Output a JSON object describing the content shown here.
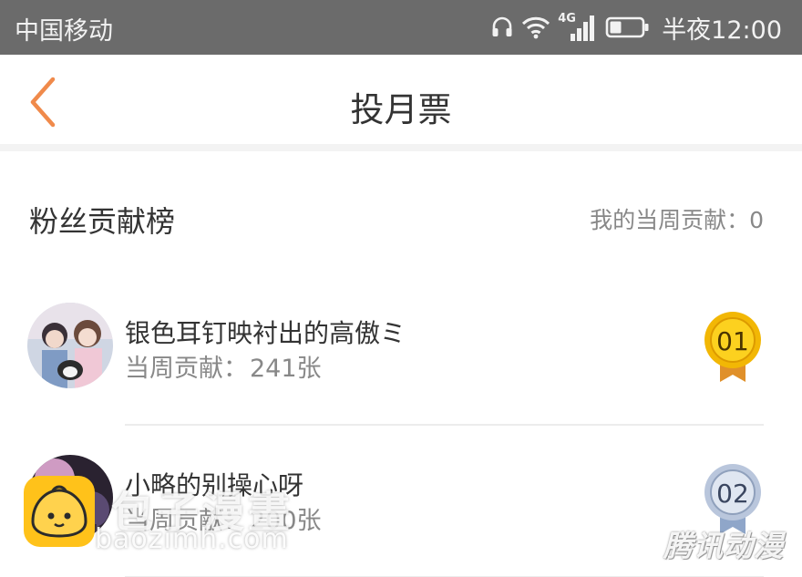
{
  "status_bar": {
    "carrier": "中国移动",
    "network_label": "4G",
    "clock": "半夜12:00",
    "icons": [
      "headphones-icon",
      "wifi-icon",
      "signal-icon",
      "battery-icon"
    ]
  },
  "nav": {
    "title": "投月票",
    "back_icon": "chevron-left-icon",
    "accent_color": "#f08a4b"
  },
  "section": {
    "title": "粉丝贡献榜",
    "my_contribution": "我的当周贡献：0"
  },
  "ranking": [
    {
      "rank": "01",
      "name": "银色耳钉映衬出的高傲ミ",
      "contribution_label": "当周贡献：",
      "contribution_value": "241张",
      "medal_color": "#f2b705",
      "ribbon_color": "#e0902a"
    },
    {
      "rank": "02",
      "name": "小略的别操心呀",
      "contribution_label": "当周贡献：",
      "contribution_value": "200张",
      "medal_color": "#b9c6dc",
      "ribbon_color": "#8fa6c9"
    }
  ],
  "watermarks": {
    "brand": "包子漫畫",
    "url": "baozimh.com",
    "corner": "腾讯动漫"
  }
}
